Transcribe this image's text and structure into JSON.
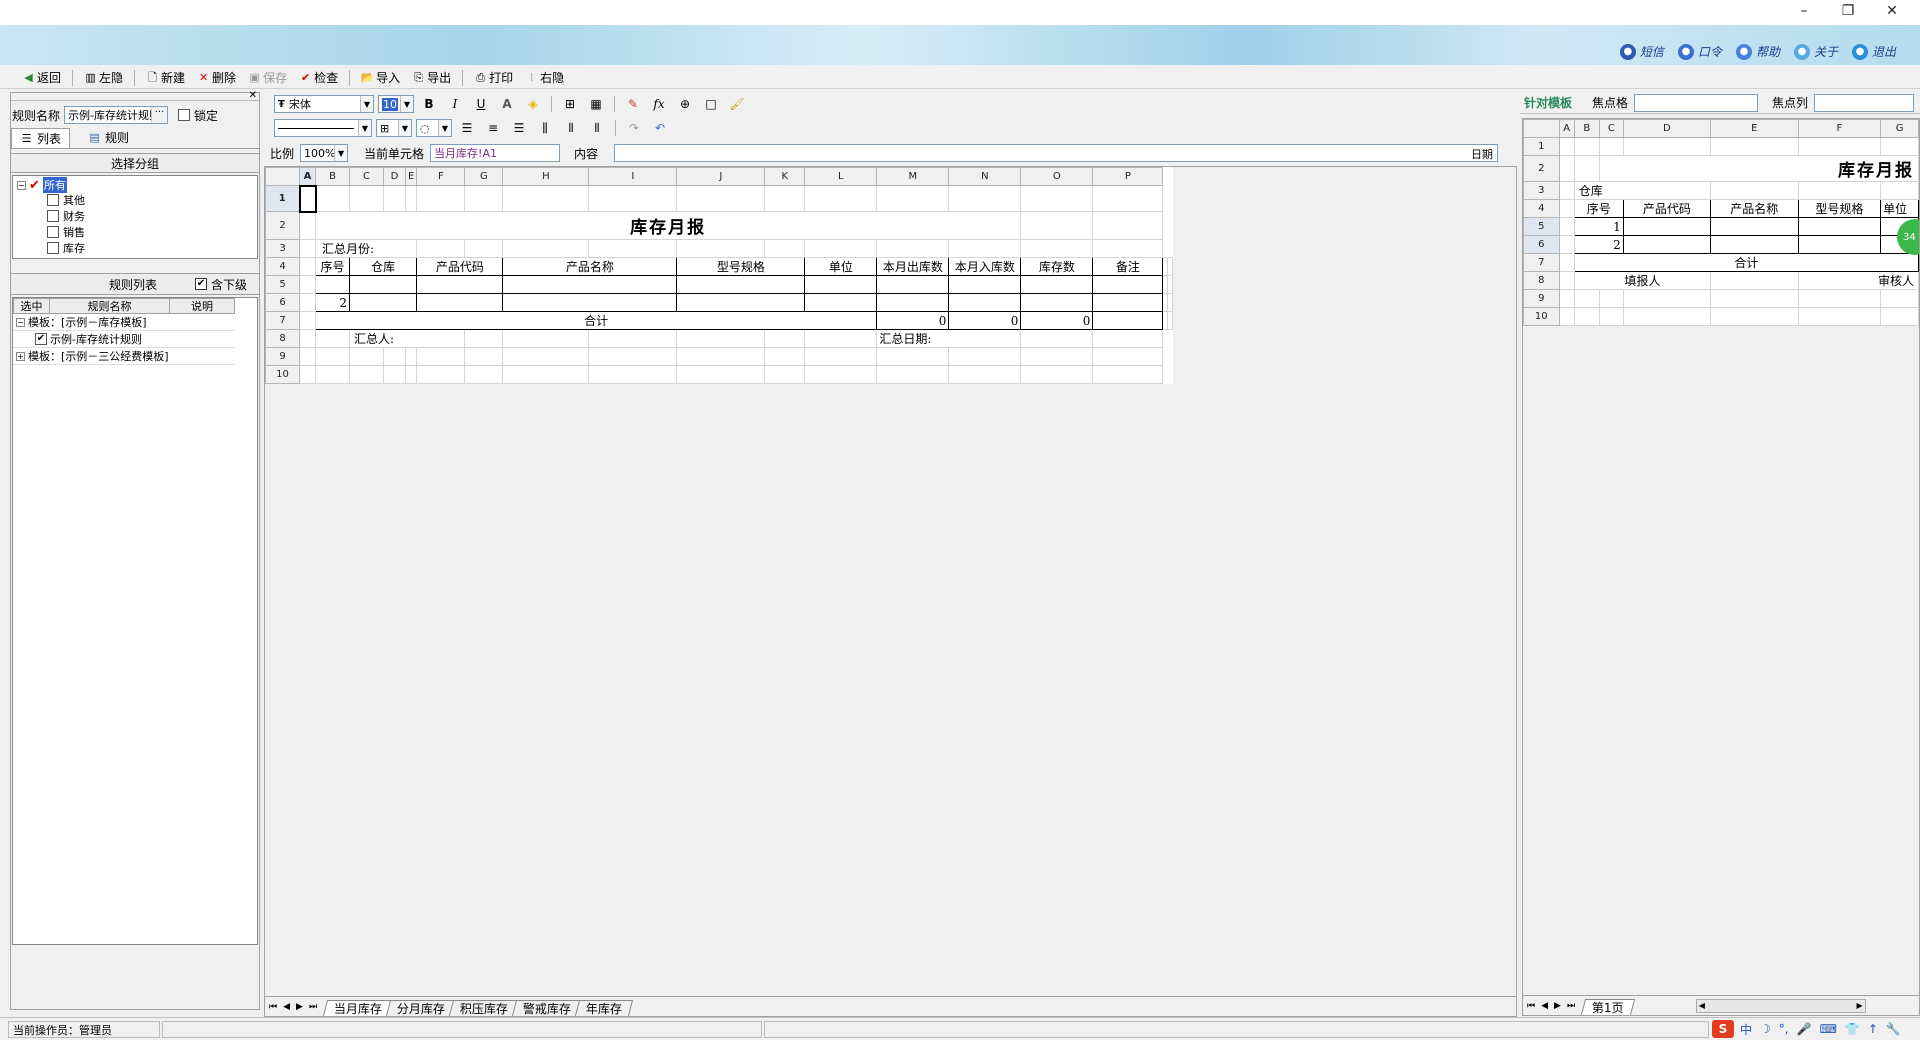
{
  "window": {
    "min": "–",
    "restore": "❐",
    "close": "✕"
  },
  "banner_links": [
    {
      "label": "短信",
      "icon": "message-icon",
      "color": "#2a5db0"
    },
    {
      "label": "口令",
      "icon": "lock-icon",
      "color": "#3a6fd0"
    },
    {
      "label": "帮助",
      "icon": "help-icon",
      "color": "#4a7fe0"
    },
    {
      "label": "关于",
      "icon": "about-icon",
      "color": "#57a7e0"
    },
    {
      "label": "退出",
      "icon": "exit-icon",
      "color": "#2b8fd8"
    }
  ],
  "toolbar": {
    "back": "返回",
    "left_hide": "左隐",
    "new": "新建",
    "delete": "删除",
    "save": "保存",
    "check": "检查",
    "import": "导入",
    "export": "导出",
    "print": "打印",
    "right_hide": "右隐"
  },
  "left": {
    "rule_name_label": "规则名称",
    "rule_name_value": "示例-库存统计规则",
    "lock_label": "锁定",
    "tab_list": "列表",
    "tab_rule": "规则",
    "select_group_title": "选择分组",
    "tree_root": "所有",
    "tree_items": [
      "其他",
      "财务",
      "销售",
      "库存"
    ],
    "rule_list_title": "规则列表",
    "include_sub_label": "含下级",
    "grid_headers": [
      "选中",
      "规则名称",
      "说明"
    ],
    "grid_rows": [
      {
        "expander": "−",
        "text": "模板：[示例－库存模板]",
        "checked": null
      },
      {
        "expander": "",
        "text": "示例-库存统计规则",
        "checked": true
      },
      {
        "expander": "+",
        "text": "模板：[示例－三公经费模板]",
        "checked": null
      }
    ]
  },
  "format": {
    "font": "宋体",
    "size": "10",
    "ratio_label": "比例",
    "ratio_value": "100%",
    "current_cell_label": "当前单元格",
    "current_cell_value": "当月库存!A1",
    "content_label": "内容",
    "content_value": "",
    "date_btn": "日期"
  },
  "sheet": {
    "columns": [
      "A",
      "B",
      "C",
      "D",
      "E",
      "F",
      "G",
      "H",
      "I",
      "J",
      "K",
      "L",
      "M",
      "N",
      "O",
      "P"
    ],
    "rows": [
      "1",
      "2",
      "3",
      "4",
      "5",
      "6",
      "7",
      "8",
      "9",
      "10"
    ],
    "title": "库存月报",
    "summary_month": "汇总月份:",
    "headers": [
      "序号",
      "仓库",
      "产品代码",
      "产品名称",
      "型号规格",
      "单位",
      "本月出库数",
      "本月入库数",
      "库存数",
      "备注"
    ],
    "row6_seq": "2",
    "total_label": "合计",
    "totals": [
      "0",
      "0",
      "0"
    ],
    "summarizer": "汇总人:",
    "summary_date": "汇总日期:"
  },
  "sheet_tabs": [
    "当月库存",
    "分月库存",
    "积压库存",
    "警戒库存",
    "年库存"
  ],
  "right": {
    "template_label": "针对模板",
    "focus_cell_label": "焦点格",
    "focus_col_label": "焦点列",
    "columns": [
      "A",
      "B",
      "C",
      "D",
      "E",
      "F",
      "G"
    ],
    "rows": [
      "1",
      "2",
      "3",
      "4",
      "5",
      "6",
      "7",
      "8",
      "9",
      "10"
    ],
    "title": "库存月报",
    "warehouse": "仓库",
    "headers": [
      "序号",
      "产品代码",
      "产品名称",
      "型号规格",
      "单位"
    ],
    "row5_seq": "1",
    "row6_seq": "2",
    "total_label": "合计",
    "filler": "填报人",
    "reviewer": "审核人",
    "badge": "34",
    "page_tab": "第1页"
  },
  "status": {
    "operator": "当前操作员：管理员",
    "ime": [
      "中",
      "☽",
      "°,",
      "🎤",
      "⌨",
      "👕",
      "↑",
      "🔧"
    ]
  }
}
